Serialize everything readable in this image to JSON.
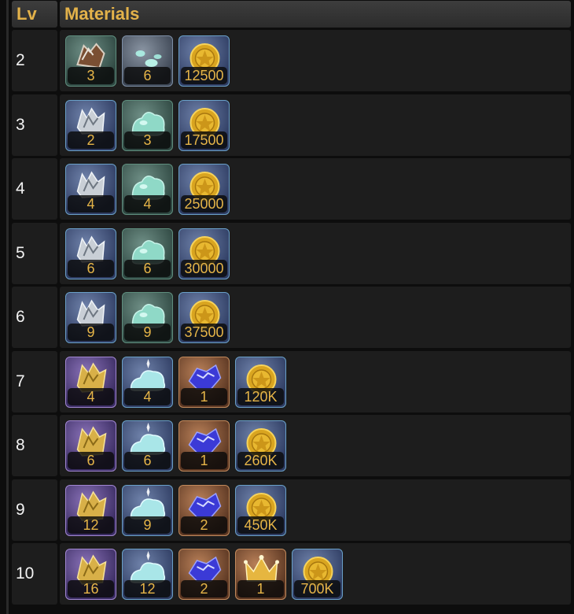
{
  "header": {
    "lv_label": "Lv",
    "materials_label": "Materials"
  },
  "rows": [
    {
      "level": "2",
      "items": [
        {
          "icon": "scrap-icon",
          "bg": "green",
          "qty": "3"
        },
        {
          "icon": "droplets-icon",
          "bg": "grey",
          "qty": "6"
        },
        {
          "icon": "gold-coin-icon",
          "bg": "blue",
          "qty": "12500"
        }
      ]
    },
    {
      "level": "3",
      "items": [
        {
          "icon": "metal-shards-icon",
          "bg": "blue",
          "qty": "2"
        },
        {
          "icon": "slime-blob-icon",
          "bg": "green",
          "qty": "3"
        },
        {
          "icon": "gold-coin-icon",
          "bg": "blue",
          "qty": "17500"
        }
      ]
    },
    {
      "level": "4",
      "items": [
        {
          "icon": "metal-shards-icon",
          "bg": "blue",
          "qty": "4"
        },
        {
          "icon": "slime-blob-icon",
          "bg": "green",
          "qty": "4"
        },
        {
          "icon": "gold-coin-icon",
          "bg": "blue",
          "qty": "25000"
        }
      ]
    },
    {
      "level": "5",
      "items": [
        {
          "icon": "metal-shards-icon",
          "bg": "blue",
          "qty": "6"
        },
        {
          "icon": "slime-blob-icon",
          "bg": "green",
          "qty": "6"
        },
        {
          "icon": "gold-coin-icon",
          "bg": "blue",
          "qty": "30000"
        }
      ]
    },
    {
      "level": "6",
      "items": [
        {
          "icon": "metal-shards-icon",
          "bg": "blue",
          "qty": "9"
        },
        {
          "icon": "slime-blob-icon",
          "bg": "green",
          "qty": "9"
        },
        {
          "icon": "gold-coin-icon",
          "bg": "blue",
          "qty": "37500"
        }
      ]
    },
    {
      "level": "7",
      "items": [
        {
          "icon": "gold-shards-icon",
          "bg": "purple",
          "qty": "4"
        },
        {
          "icon": "crystal-cloud-icon",
          "bg": "blue",
          "qty": "4"
        },
        {
          "icon": "blue-crystal-icon",
          "bg": "orange",
          "qty": "1"
        },
        {
          "icon": "gold-coin-icon",
          "bg": "blue",
          "qty": "120K"
        }
      ]
    },
    {
      "level": "8",
      "items": [
        {
          "icon": "gold-shards-icon",
          "bg": "purple",
          "qty": "6"
        },
        {
          "icon": "crystal-cloud-icon",
          "bg": "blue",
          "qty": "6"
        },
        {
          "icon": "blue-crystal-icon",
          "bg": "orange",
          "qty": "1"
        },
        {
          "icon": "gold-coin-icon",
          "bg": "blue",
          "qty": "260K"
        }
      ]
    },
    {
      "level": "9",
      "items": [
        {
          "icon": "gold-shards-icon",
          "bg": "purple",
          "qty": "12"
        },
        {
          "icon": "crystal-cloud-icon",
          "bg": "blue",
          "qty": "9"
        },
        {
          "icon": "blue-crystal-icon",
          "bg": "orange",
          "qty": "2"
        },
        {
          "icon": "gold-coin-icon",
          "bg": "blue",
          "qty": "450K"
        }
      ]
    },
    {
      "level": "10",
      "items": [
        {
          "icon": "gold-shards-icon",
          "bg": "purple",
          "qty": "16"
        },
        {
          "icon": "crystal-cloud-icon",
          "bg": "blue",
          "qty": "12"
        },
        {
          "icon": "blue-crystal-icon",
          "bg": "orange",
          "qty": "2"
        },
        {
          "icon": "crown-icon",
          "bg": "orange",
          "qty": "1"
        },
        {
          "icon": "gold-coin-icon",
          "bg": "blue",
          "qty": "700K"
        }
      ]
    }
  ]
}
